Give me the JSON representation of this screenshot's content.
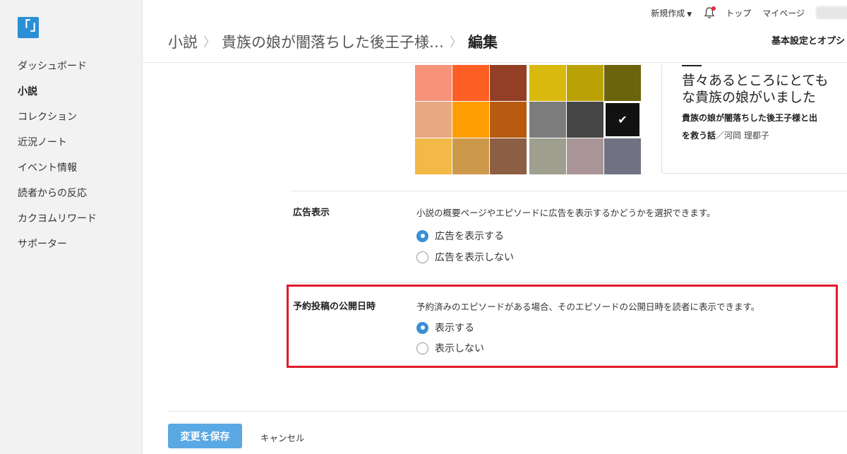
{
  "logo": {
    "glyph": "「」"
  },
  "sidebar": {
    "items": [
      {
        "label": "ダッシュボード"
      },
      {
        "label": "小説"
      },
      {
        "label": "コレクション"
      },
      {
        "label": "近況ノート"
      },
      {
        "label": "イベント情報"
      },
      {
        "label": "読者からの反応"
      },
      {
        "label": "カクヨムリワード"
      },
      {
        "label": "サポーター"
      }
    ],
    "active_index": 1
  },
  "topbar": {
    "new_label": "新規作成",
    "top_label": "トップ",
    "mypage_label": "マイページ"
  },
  "breadcrumb": {
    "root": "小説",
    "work": "貴族の娘が闇落ちした後王子様…",
    "current": "編集"
  },
  "tabs": {
    "settings": "基本設定とオプシ"
  },
  "colors": {
    "accent": "#3a8fd6",
    "highlight": "#e01b2a",
    "swatches": [
      "#f7937a",
      "#fd5e23",
      "#923f26",
      "#d9b90e",
      "#baa205",
      "#6c630d",
      "#e8a884",
      "#fd9d00",
      "#b85a0f",
      "#7c7c7c",
      "#464646",
      "#111111",
      "#f2b946",
      "#cc984a",
      "#8c5f45",
      "#9e9f8e",
      "#a99597",
      "#717281"
    ],
    "selected_index": 11
  },
  "preview": {
    "title": "昔々あるところにとても\nな貴族の娘がいました",
    "subtitle": "貴族の娘が闇落ちした後王子様と出\nを救う話",
    "author": "／河岡 理都子"
  },
  "ads": {
    "label": "広告表示",
    "description": "小説の概要ページやエピソードに広告を表示するかどうかを選択できます。",
    "options": [
      "広告を表示する",
      "広告を表示しない"
    ],
    "selected": 0
  },
  "schedule": {
    "label": "予約投稿の公開日時",
    "description": "予約済みのエピソードがある場合、そのエピソードの公開日時を読者に表示できます。",
    "options": [
      "表示する",
      "表示しない"
    ],
    "selected": 0
  },
  "footer": {
    "save_label": "変更を保存",
    "cancel_label": "キャンセル"
  }
}
